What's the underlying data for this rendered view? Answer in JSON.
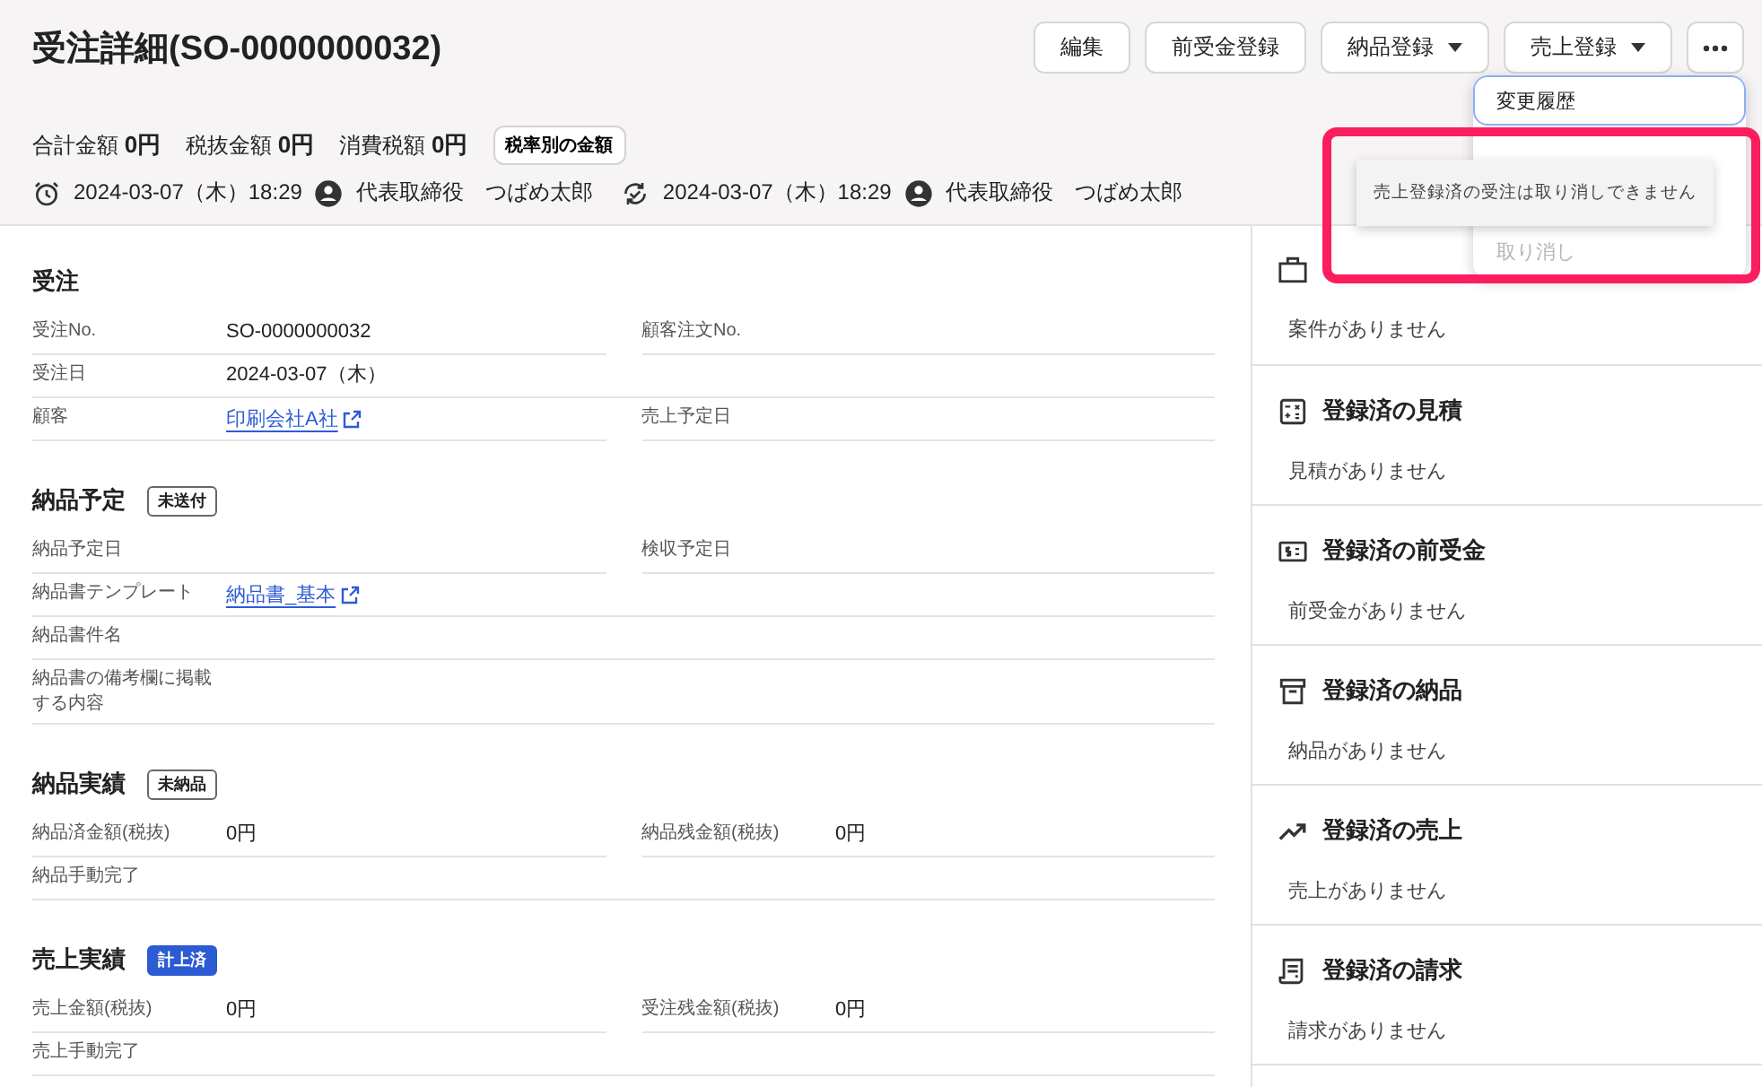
{
  "page": {
    "title": "受注詳細(SO-0000000032)"
  },
  "actions": [
    {
      "kind": "button",
      "label": "編集"
    },
    {
      "kind": "button",
      "label": "前受金登録"
    },
    {
      "kind": "dropdown",
      "label": "納品登録"
    },
    {
      "kind": "dropdown",
      "label": "売上登録"
    },
    {
      "kind": "more"
    }
  ],
  "summary": [
    {
      "label": "合計金額",
      "value": "0円"
    },
    {
      "label": "税抜金額",
      "value": "0円"
    },
    {
      "label": "消費税額",
      "value": "0円"
    }
  ],
  "summary_button": "税率別の金額",
  "history": [
    {
      "kind": "created",
      "time": "2024-03-07（木）18:29",
      "user": "代表取締役　つばめ太郎"
    },
    {
      "kind": "updated",
      "time": "2024-03-07（木）18:29",
      "user": "代表取締役　つばめ太郎"
    }
  ],
  "sections": [
    {
      "title": "受注",
      "rows": [
        [
          {
            "label": "受注No.",
            "value": "SO-0000000032"
          },
          {
            "label": "顧客注文No."
          }
        ],
        [
          {
            "label": "受注日",
            "value": "2024-03-07（木）"
          }
        ],
        [
          {
            "label": "顧客",
            "value": "印刷会社A社",
            "kind": "link"
          },
          {
            "label": "売上予定日"
          }
        ]
      ]
    },
    {
      "title": "納品予定",
      "badge": {
        "label": "未送付",
        "kind": "outline"
      },
      "rows": [
        [
          {
            "label": "納品予定日"
          },
          {
            "label": "検収予定日"
          }
        ],
        [
          {
            "label": "納品書テンプレート",
            "value": "納品書_基本",
            "kind": "link"
          }
        ],
        [
          {
            "label": "納品書件名"
          }
        ],
        [
          {
            "label": "納品書の備考欄に掲載する内容"
          }
        ]
      ]
    },
    {
      "title": "納品実績",
      "badge": {
        "label": "未納品",
        "kind": "outline"
      },
      "rows": [
        [
          {
            "label": "納品済金額(税抜)",
            "value": "0円"
          },
          {
            "label": "納品残金額(税抜)",
            "value": "0円"
          }
        ],
        [
          {
            "label": "納品手動完了"
          }
        ]
      ]
    },
    {
      "title": "売上実績",
      "badge": {
        "label": "計上済",
        "kind": "filled"
      },
      "rows": [
        [
          {
            "label": "売上金額(税抜)",
            "value": "0円"
          },
          {
            "label": "受注残金額(税抜)",
            "value": "0円"
          }
        ],
        [
          {
            "label": "売上手動完了"
          }
        ]
      ]
    }
  ],
  "side": [
    {
      "kind": "project",
      "empty": "案件がありません"
    },
    {
      "kind": "estimate",
      "title": "登録済の見積",
      "empty": "見積がありません"
    },
    {
      "kind": "advance",
      "title": "登録済の前受金",
      "empty": "前受金がありません"
    },
    {
      "kind": "delivery",
      "title": "登録済の納品",
      "empty": "納品がありません"
    },
    {
      "kind": "sales",
      "title": "登録済の売上",
      "empty": "売上がありません"
    },
    {
      "kind": "invoice",
      "title": "登録済の請求",
      "empty": "請求がありません"
    }
  ],
  "menu": [
    {
      "label": "変更履歴",
      "disabled": false,
      "focused": true
    },
    {
      "label": "取り消し",
      "disabled": true,
      "focused": false
    }
  ],
  "tooltip": "売上登録済の受注は取り消しできません",
  "highlight": {
    "kind": "box"
  }
}
